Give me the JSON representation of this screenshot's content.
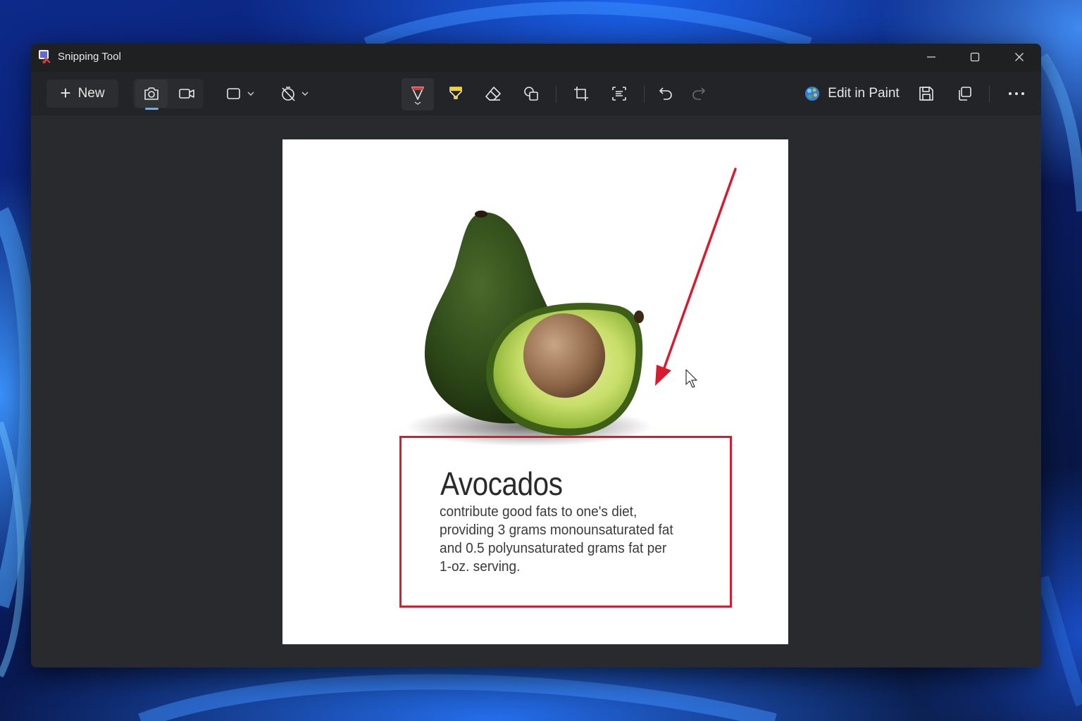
{
  "window": {
    "title": "Snipping Tool"
  },
  "toolbar": {
    "new_label": "New",
    "edit_in_paint_label": "Edit in Paint"
  },
  "document": {
    "heading": "Avocados",
    "body_lines": [
      "contribute good fats to one's diet,",
      "providing 3 grams monounsaturated fat",
      "and 0.5 polyunsaturated grams fat per",
      "1-oz. serving."
    ]
  },
  "colors": {
    "accent": "#5ab5f0",
    "annotation_red": "#d81b2d",
    "window_bg": "#202124"
  }
}
